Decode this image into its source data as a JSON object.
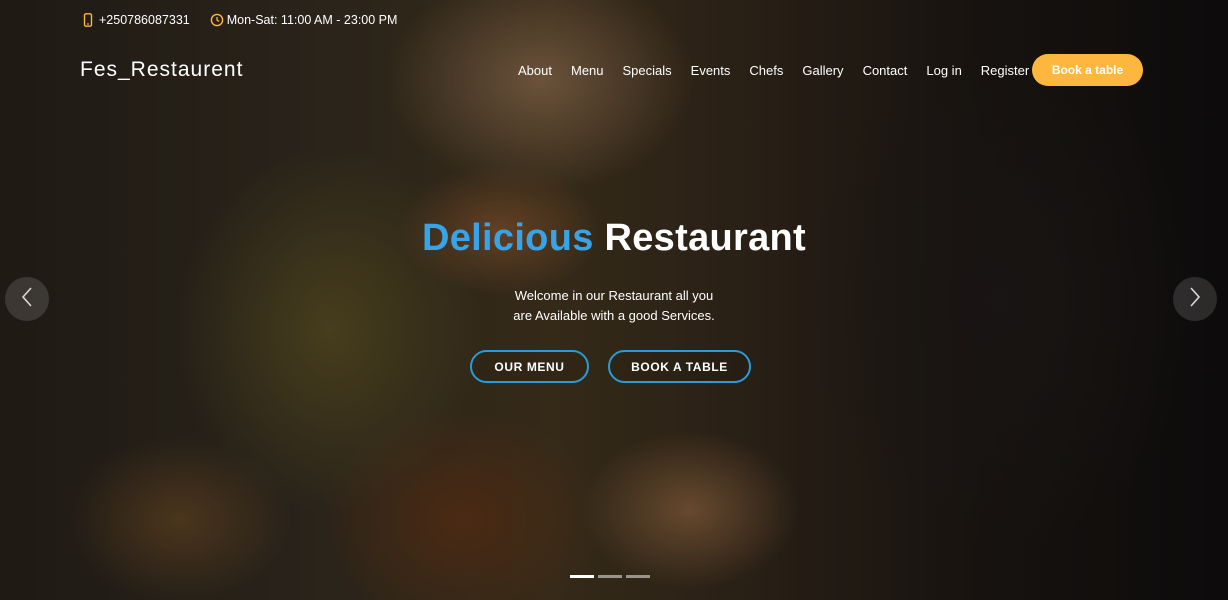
{
  "topbar": {
    "phone": "+250786087331",
    "hours": "Mon-Sat: 11:00 AM - 23:00 PM",
    "phone_icon": "phone-icon",
    "clock_icon": "clock-icon",
    "icon_color": "#fdb73e"
  },
  "header": {
    "logo": "Fes_Restaurent",
    "nav": [
      "About",
      "Menu",
      "Specials",
      "Events",
      "Chefs",
      "Gallery",
      "Contact",
      "Log in",
      "Register"
    ],
    "book_button": "Book a table",
    "book_button_color": "#fdb73e"
  },
  "hero": {
    "title_accent": "Delicious",
    "title_rest": "Restaurant",
    "accent_color": "#38a3e6",
    "subtitle_line1": "Welcome in our Restaurant all you",
    "subtitle_line2": "are Available with a good Services.",
    "btn_menu": "OUR MENU",
    "btn_table": "BOOK A TABLE",
    "btn_border_color": "#2a9bd8"
  },
  "carousel": {
    "prev_icon": "chevron-left-icon",
    "next_icon": "chevron-right-icon",
    "slide_count": 3,
    "active_slide": 1
  }
}
